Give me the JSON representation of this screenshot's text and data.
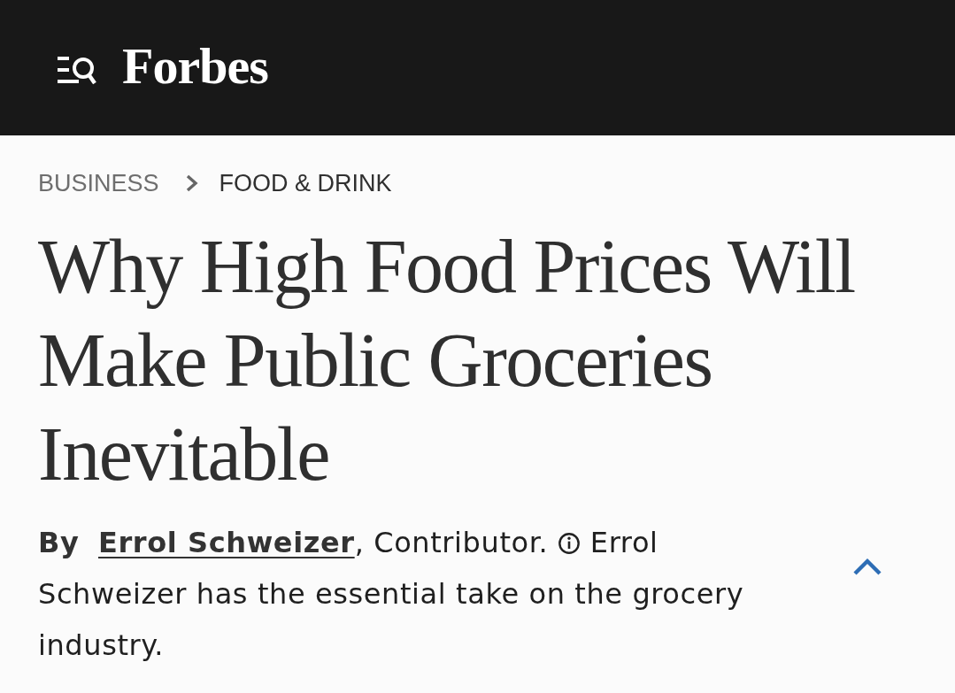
{
  "header": {
    "logo": "Forbes"
  },
  "breadcrumb": [
    {
      "label": "BUSINESS",
      "current": false
    },
    {
      "label": "FOOD & DRINK",
      "current": true
    }
  ],
  "headline": "Why High Food Prices Will Make Public Groceries Inevitable",
  "byline": {
    "prefix": "By",
    "author": "Errol Schweizer",
    "role": ", Contributor.",
    "bio": "Errol Schweizer has the essential take on the grocery industry."
  }
}
